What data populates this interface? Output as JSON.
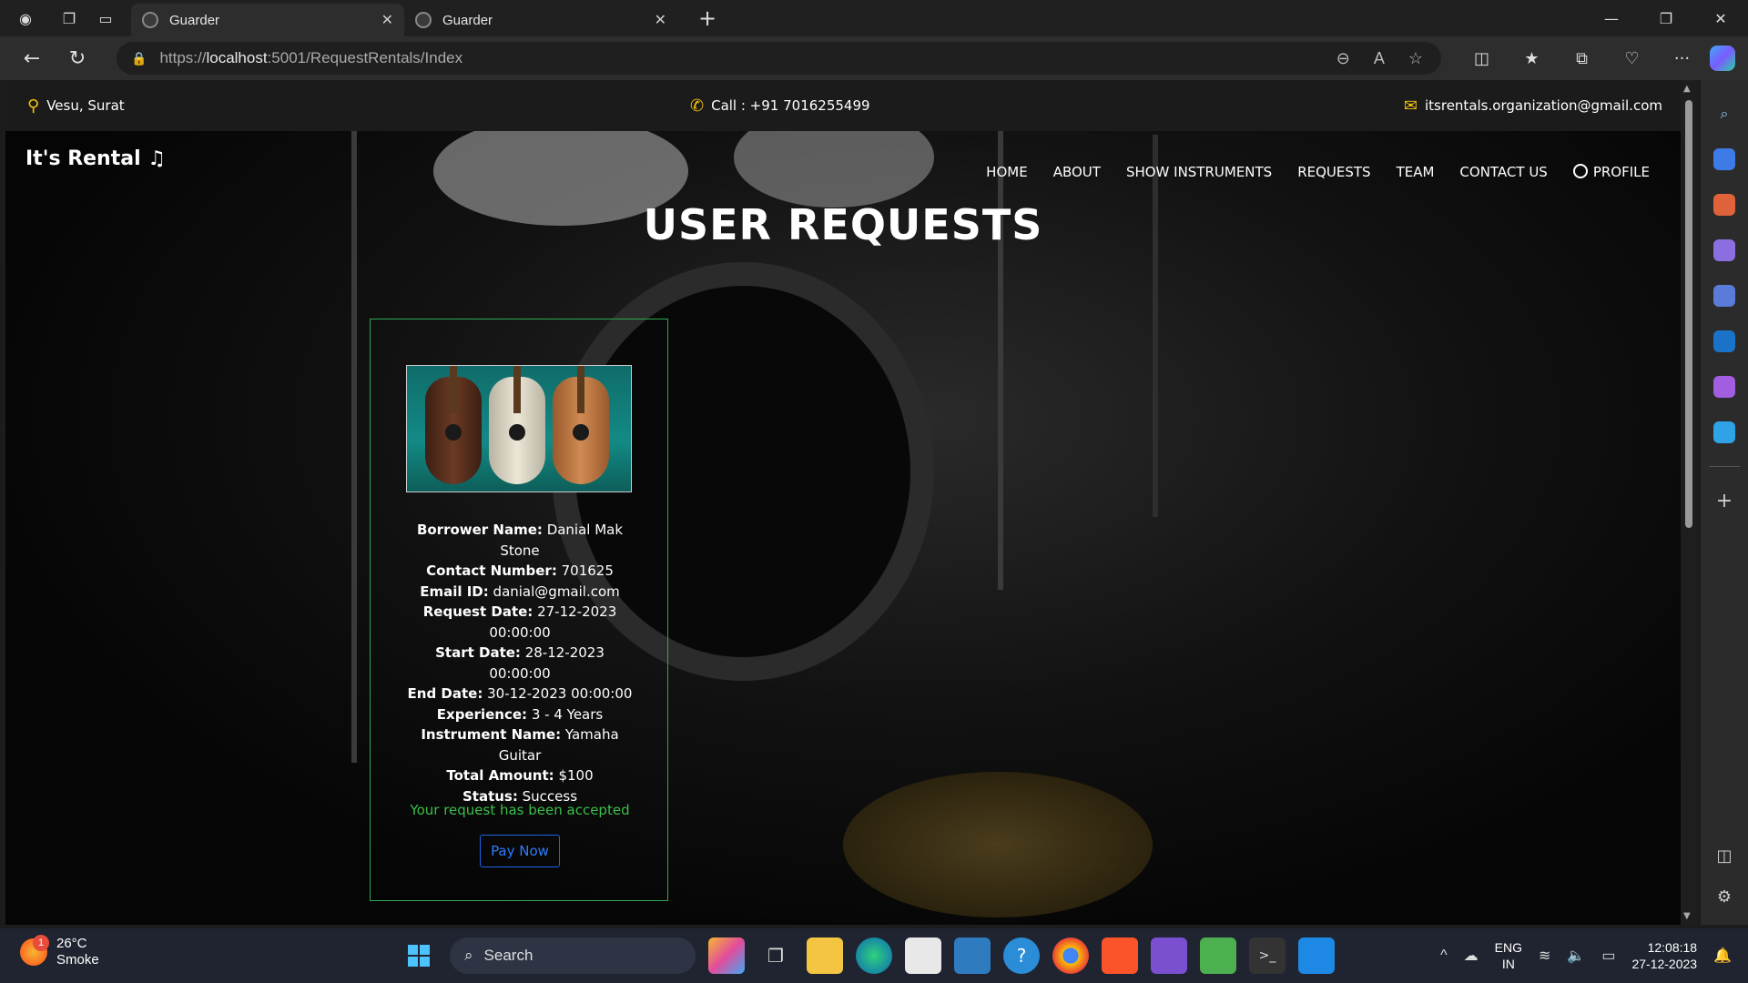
{
  "browser": {
    "tabs": [
      {
        "title": "Guarder",
        "active": true
      },
      {
        "title": "Guarder",
        "active": false
      }
    ],
    "url_prefix": "https://",
    "url_host": "localhost",
    "url_rest": ":5001/RequestRentals/Index"
  },
  "topbar": {
    "location": "Vesu, Surat",
    "call": "Call : +91 7016255499",
    "email": "itsrentals.organization@gmail.com"
  },
  "brand": "It's Rental ♫",
  "nav": {
    "home": "HOME",
    "about": "ABOUT",
    "show_instruments": "SHOW INSTRUMENTS",
    "requests": "REQUESTS",
    "team": "TEAM",
    "contact": "CONTACT US",
    "profile": "PROFILE"
  },
  "page_title": "USER REQUESTS",
  "request": {
    "borrower_label": "Borrower Name:",
    "borrower": "Danial Mak Stone",
    "contact_label": "Contact Number:",
    "contact": "701625",
    "email_label": "Email ID:",
    "email": "danial@gmail.com",
    "request_date_label": "Request Date:",
    "request_date": "27-12-2023 00:00:00",
    "start_date_label": "Start Date:",
    "start_date": "28-12-2023 00:00:00",
    "end_date_label": "End Date:",
    "end_date": "30-12-2023 00:00:00",
    "experience_label": "Experience:",
    "experience": "3 - 4 Years",
    "instrument_label": "Instrument Name:",
    "instrument": "Yamaha Guitar",
    "total_label": "Total Amount:",
    "total": "$100",
    "status_label": "Status:",
    "status": "Success",
    "message": "Your request has been accepted",
    "pay_button": "Pay Now"
  },
  "taskbar": {
    "weather_badge": "1",
    "temperature": "26°C",
    "condition": "Smoke",
    "search": "Search",
    "lang_top": "ENG",
    "lang_bottom": "IN",
    "time": "12:08:18",
    "date": "27-12-2023"
  },
  "colors": {
    "accent_green": "#2fa84f",
    "pay_blue": "#1e63e6",
    "icon_yellow": "#f4c20d"
  }
}
